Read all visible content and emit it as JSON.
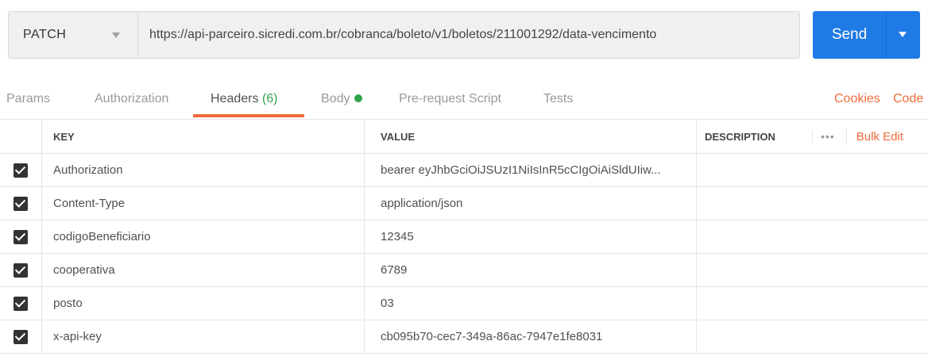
{
  "request": {
    "method": "PATCH",
    "url": "https://api-parceiro.sicredi.com.br/cobranca/boleto/v1/boletos/211001292/data-vencimento",
    "send_label": "Send"
  },
  "tabs": {
    "params": "Params",
    "authorization": "Authorization",
    "headers": "Headers",
    "headers_count": "(6)",
    "body": "Body",
    "pre_request": "Pre-request Script",
    "tests": "Tests",
    "cookies": "Cookies",
    "code": "Code"
  },
  "table": {
    "columns": {
      "key": "KEY",
      "value": "VALUE",
      "description": "DESCRIPTION"
    },
    "more_label": "•••",
    "bulk_edit": "Bulk Edit",
    "rows": [
      {
        "key": "Authorization",
        "value": "bearer eyJhbGciOiJSUzI1NiIsInR5cCIgOiAiSldUIiw...",
        "checked": true
      },
      {
        "key": "Content-Type",
        "value": "application/json",
        "checked": true
      },
      {
        "key": "codigoBeneficiario",
        "value": "12345",
        "checked": true
      },
      {
        "key": "cooperativa",
        "value": "6789",
        "checked": true
      },
      {
        "key": "posto",
        "value": "03",
        "checked": true
      },
      {
        "key": "x-api-key",
        "value": "cb095b70-cec7-349a-86ac-7947e1fe8031",
        "checked": true
      }
    ]
  },
  "colors": {
    "accent": "#f26b3a",
    "send": "#1f7ae5",
    "success": "#2fa34a"
  }
}
